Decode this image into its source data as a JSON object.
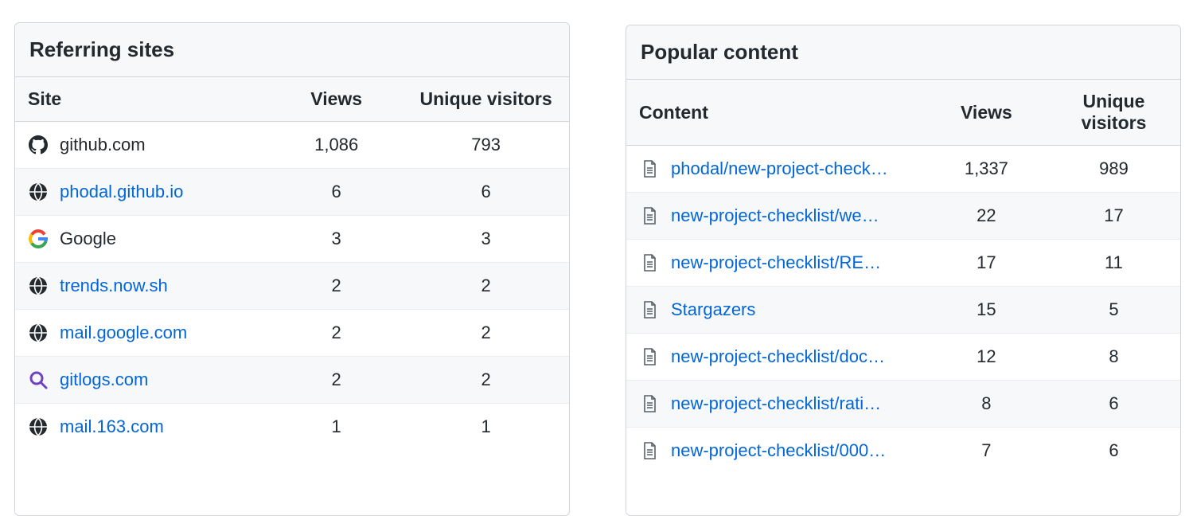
{
  "referring": {
    "title": "Referring sites",
    "columns": {
      "name": "Site",
      "views": "Views",
      "unique": "Unique visitors"
    },
    "rows": [
      {
        "icon": "github",
        "label": "github.com",
        "link": false,
        "views": "1,086",
        "unique": "793"
      },
      {
        "icon": "globe",
        "label": "phodal.github.io",
        "link": true,
        "views": "6",
        "unique": "6"
      },
      {
        "icon": "google",
        "label": "Google",
        "link": false,
        "views": "3",
        "unique": "3"
      },
      {
        "icon": "globe",
        "label": "trends.now.sh",
        "link": true,
        "views": "2",
        "unique": "2"
      },
      {
        "icon": "globe",
        "label": "mail.google.com",
        "link": true,
        "views": "2",
        "unique": "2"
      },
      {
        "icon": "magnify",
        "label": "gitlogs.com",
        "link": true,
        "views": "2",
        "unique": "2"
      },
      {
        "icon": "globe",
        "label": "mail.163.com",
        "link": true,
        "views": "1",
        "unique": "1"
      }
    ]
  },
  "popular": {
    "title": "Popular content",
    "columns": {
      "name": "Content",
      "views": "Views",
      "unique": "Unique visitors"
    },
    "rows": [
      {
        "icon": "file",
        "label": "phodal/new-project-check…",
        "link": true,
        "views": "1,337",
        "unique": "989"
      },
      {
        "icon": "file",
        "label": "new-project-checklist/we…",
        "link": true,
        "views": "22",
        "unique": "17"
      },
      {
        "icon": "file",
        "label": "new-project-checklist/RE…",
        "link": true,
        "views": "17",
        "unique": "11"
      },
      {
        "icon": "file",
        "label": "Stargazers",
        "link": true,
        "views": "15",
        "unique": "5"
      },
      {
        "icon": "file",
        "label": "new-project-checklist/doc…",
        "link": true,
        "views": "12",
        "unique": "8"
      },
      {
        "icon": "file",
        "label": "new-project-checklist/rati…",
        "link": true,
        "views": "8",
        "unique": "6"
      },
      {
        "icon": "file",
        "label": "new-project-checklist/000…",
        "link": true,
        "views": "7",
        "unique": "6"
      }
    ]
  }
}
